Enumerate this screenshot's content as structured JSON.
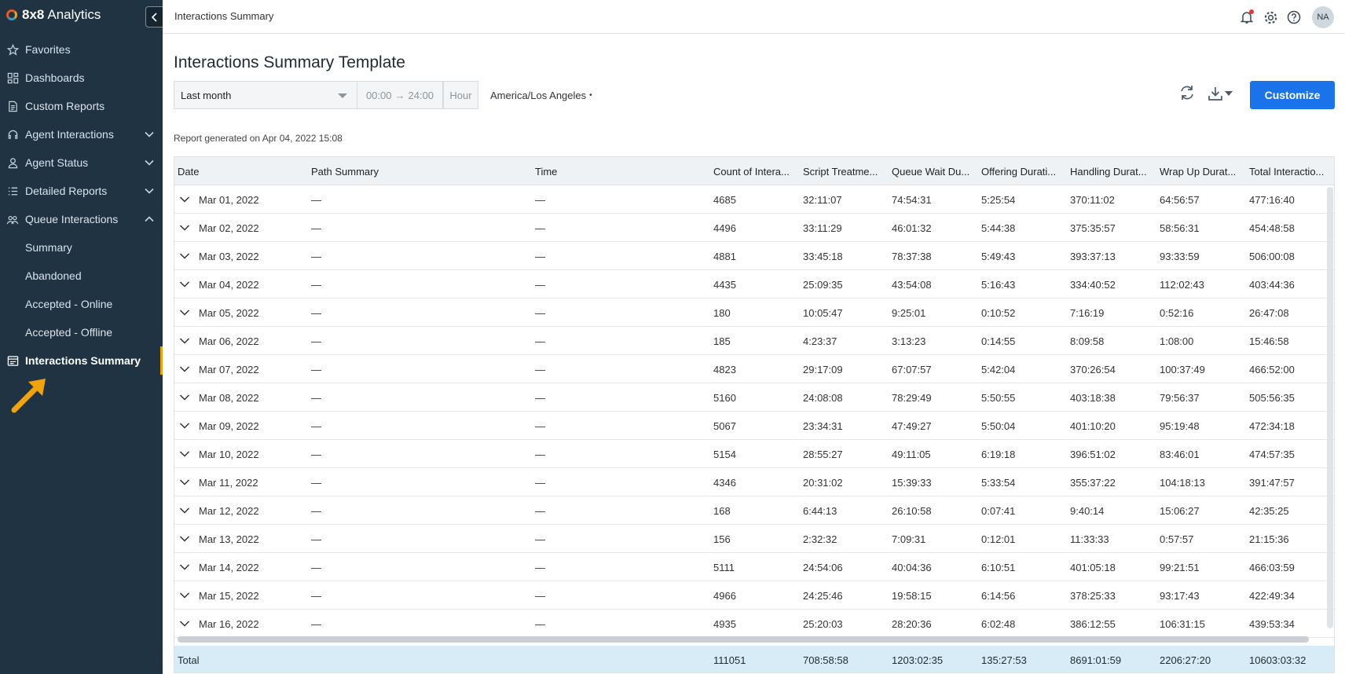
{
  "app": {
    "brand_bold": "8x8",
    "brand_rest": "Analytics"
  },
  "sidebar": {
    "items": [
      {
        "label": "Favorites",
        "icon": "star-icon"
      },
      {
        "label": "Dashboards",
        "icon": "grid-icon"
      },
      {
        "label": "Custom Reports",
        "icon": "document-icon"
      },
      {
        "label": "Agent Interactions",
        "icon": "headset-icon",
        "chevron": "down"
      },
      {
        "label": "Agent Status",
        "icon": "person-icon",
        "chevron": "down"
      },
      {
        "label": "Detailed Reports",
        "icon": "list-icon",
        "chevron": "down"
      },
      {
        "label": "Queue Interactions",
        "icon": "group-icon",
        "chevron": "up"
      }
    ],
    "subitems": [
      "Summary",
      "Abandoned",
      "Accepted - Online",
      "Accepted - Offline"
    ],
    "active_item": "Interactions Summary"
  },
  "header": {
    "breadcrumb": "Interactions Summary",
    "avatar_initials": "NA"
  },
  "main": {
    "title": "Interactions Summary Template",
    "period": "Last month",
    "time_from": "00:00",
    "time_to": "24:00",
    "granularity": "Hour",
    "timezone": "America/Los Angeles",
    "customize_label": "Customize",
    "generated": "Report generated on Apr 04, 2022 15:08"
  },
  "table": {
    "columns": [
      "Date",
      "Path Summary",
      "Time",
      "Count of Intera...",
      "Script Treatme...",
      "Queue Wait Du...",
      "Offering Durati...",
      "Handling Durat...",
      "Wrap Up Durat...",
      "Total Interactio..."
    ],
    "rows": [
      [
        "Mar 01, 2022",
        "—",
        "—",
        "4685",
        "32:11:07",
        "74:54:31",
        "5:25:54",
        "370:11:02",
        "64:56:57",
        "477:16:40"
      ],
      [
        "Mar 02, 2022",
        "—",
        "—",
        "4496",
        "33:11:29",
        "46:01:32",
        "5:44:38",
        "375:35:57",
        "58:56:31",
        "454:48:58"
      ],
      [
        "Mar 03, 2022",
        "—",
        "—",
        "4881",
        "33:45:18",
        "78:37:38",
        "5:49:43",
        "393:37:13",
        "93:33:59",
        "506:00:08"
      ],
      [
        "Mar 04, 2022",
        "—",
        "—",
        "4435",
        "25:09:35",
        "43:54:08",
        "5:16:43",
        "334:40:52",
        "112:02:43",
        "403:44:36"
      ],
      [
        "Mar 05, 2022",
        "—",
        "—",
        "180",
        "10:05:47",
        "9:25:01",
        "0:10:52",
        "7:16:19",
        "0:52:16",
        "26:47:08"
      ],
      [
        "Mar 06, 2022",
        "—",
        "—",
        "185",
        "4:23:37",
        "3:13:23",
        "0:14:55",
        "8:09:58",
        "1:08:00",
        "15:46:58"
      ],
      [
        "Mar 07, 2022",
        "—",
        "—",
        "4823",
        "29:17:09",
        "67:07:57",
        "5:42:04",
        "370:26:54",
        "100:37:49",
        "466:52:00"
      ],
      [
        "Mar 08, 2022",
        "—",
        "—",
        "5160",
        "24:08:08",
        "78:29:49",
        "5:50:55",
        "403:18:38",
        "79:56:37",
        "505:56:35"
      ],
      [
        "Mar 09, 2022",
        "—",
        "—",
        "5067",
        "23:34:31",
        "47:49:27",
        "5:50:04",
        "401:10:20",
        "95:19:48",
        "472:34:18"
      ],
      [
        "Mar 10, 2022",
        "—",
        "—",
        "5154",
        "28:55:27",
        "49:11:05",
        "6:19:18",
        "396:51:02",
        "83:46:01",
        "474:57:35"
      ],
      [
        "Mar 11, 2022",
        "—",
        "—",
        "4346",
        "20:31:02",
        "15:39:33",
        "5:33:54",
        "355:37:22",
        "104:18:13",
        "391:47:57"
      ],
      [
        "Mar 12, 2022",
        "—",
        "—",
        "168",
        "6:44:13",
        "26:10:58",
        "0:07:41",
        "9:40:14",
        "15:06:27",
        "42:35:25"
      ],
      [
        "Mar 13, 2022",
        "—",
        "—",
        "156",
        "2:32:32",
        "7:09:31",
        "0:12:01",
        "11:33:33",
        "0:57:57",
        "21:15:36"
      ],
      [
        "Mar 14, 2022",
        "—",
        "—",
        "5111",
        "24:54:06",
        "40:04:36",
        "6:10:51",
        "401:05:18",
        "99:21:51",
        "466:03:59"
      ],
      [
        "Mar 15, 2022",
        "—",
        "—",
        "4966",
        "24:25:46",
        "19:58:15",
        "6:14:56",
        "378:25:33",
        "93:17:43",
        "422:49:34"
      ],
      [
        "Mar 16, 2022",
        "—",
        "—",
        "4935",
        "25:20:03",
        "28:20:36",
        "6:02:48",
        "386:12:55",
        "106:31:15",
        "439:53:34"
      ]
    ],
    "total": [
      "Total",
      "",
      "",
      "111051",
      "708:58:58",
      "1203:02:35",
      "135:27:53",
      "8691:01:59",
      "2206:27:20",
      "10603:03:32"
    ]
  },
  "colors": {
    "sidebar_bg": "#1f3342",
    "accent": "#1a73e8",
    "active_marker": "#f0a30a",
    "total_row_bg": "#d8ecf8"
  }
}
